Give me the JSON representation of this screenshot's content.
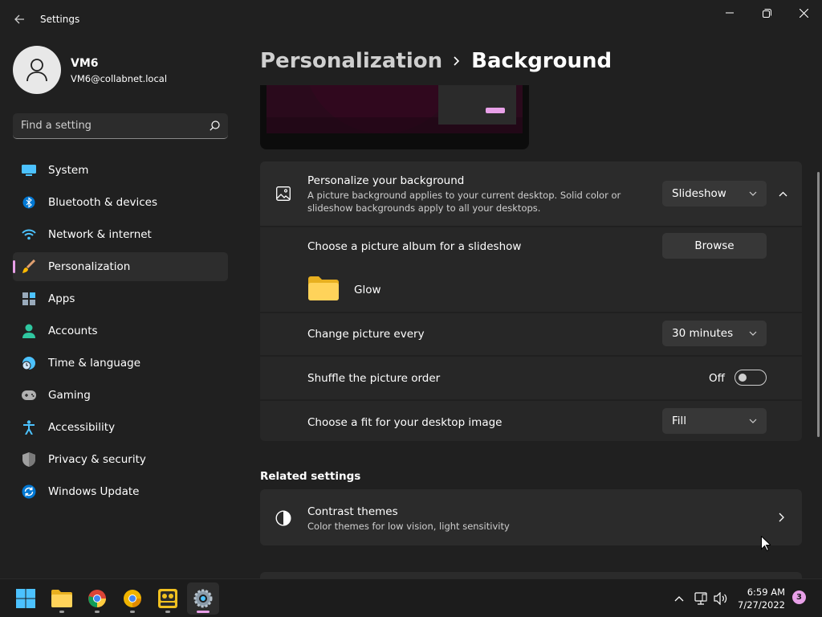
{
  "window": {
    "title": "Settings"
  },
  "profile": {
    "name": "VM6",
    "email": "VM6@collabnet.local"
  },
  "search": {
    "placeholder": "Find a setting"
  },
  "sidebar": {
    "items": [
      {
        "label": "System",
        "icon": "system-icon",
        "active": false
      },
      {
        "label": "Bluetooth & devices",
        "icon": "bluetooth-icon",
        "active": false
      },
      {
        "label": "Network & internet",
        "icon": "wifi-icon",
        "active": false
      },
      {
        "label": "Personalization",
        "icon": "brush-icon",
        "active": true
      },
      {
        "label": "Apps",
        "icon": "apps-icon",
        "active": false
      },
      {
        "label": "Accounts",
        "icon": "person-icon",
        "active": false
      },
      {
        "label": "Time & language",
        "icon": "globe-clock-icon",
        "active": false
      },
      {
        "label": "Gaming",
        "icon": "gamepad-icon",
        "active": false
      },
      {
        "label": "Accessibility",
        "icon": "accessibility-icon",
        "active": false
      },
      {
        "label": "Privacy & security",
        "icon": "shield-icon",
        "active": false
      },
      {
        "label": "Windows Update",
        "icon": "update-icon",
        "active": false
      }
    ]
  },
  "breadcrumb": {
    "parent": "Personalization",
    "current": "Background"
  },
  "background": {
    "title": "Personalize your background",
    "description_line1": "A picture background applies to your current desktop. Solid color or",
    "description_line2": "slideshow backgrounds apply to all your desktops.",
    "type_value": "Slideshow",
    "album_label": "Choose a picture album for a slideshow",
    "browse_label": "Browse",
    "folder_name": "Glow",
    "interval_label": "Change picture every",
    "interval_value": "30 minutes",
    "shuffle_label": "Shuffle the picture order",
    "shuffle_state": "Off",
    "fit_label": "Choose a fit for your desktop image",
    "fit_value": "Fill"
  },
  "related": {
    "title": "Related settings",
    "contrast_title": "Contrast themes",
    "contrast_desc": "Color themes for low vision, light sensitivity"
  },
  "taskbar": {
    "apps": [
      "start-icon",
      "file-explorer-icon",
      "chrome-icon",
      "chrome-canary-icon",
      "media-player-icon",
      "settings-icon"
    ],
    "time": "6:59 AM",
    "date": "7/27/2022",
    "notifications": "3"
  },
  "colors": {
    "accent": "#e8a0e8",
    "background": "#202020",
    "card": "#2b2b2b"
  }
}
